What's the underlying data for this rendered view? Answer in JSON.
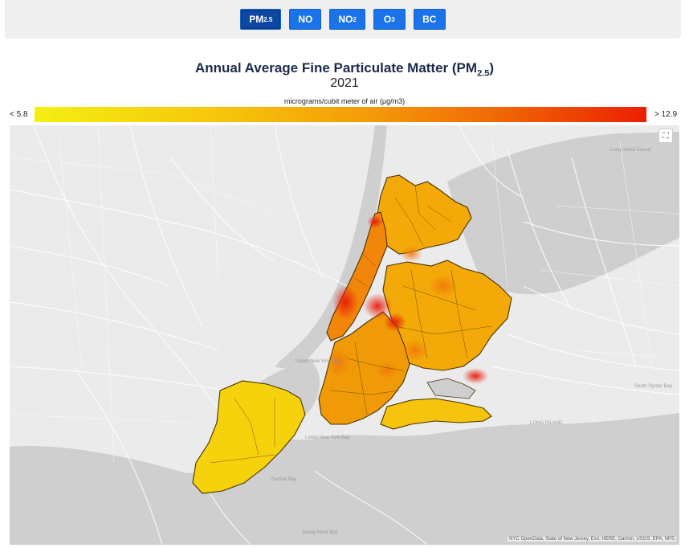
{
  "pollutant_buttons": [
    {
      "main": "PM",
      "sub": "2.5",
      "active": true
    },
    {
      "main": "NO",
      "sub": "",
      "active": false
    },
    {
      "main": "NO",
      "sub": "2",
      "active": false
    },
    {
      "main": "O",
      "sub": "3",
      "active": false
    },
    {
      "main": "BC",
      "sub": "",
      "active": false
    }
  ],
  "title": {
    "main": "Annual Average Fine Particulate Matter (PM",
    "sub": "2.5",
    "close": ")"
  },
  "year": "2021",
  "legend": {
    "units": "micrograms/cubit meter of air (μg/m3)",
    "min_label": "< 5.8",
    "max_label": "> 12.9",
    "colors": [
      "#f4ef12",
      "#f6c60c",
      "#f59a06",
      "#f06a04",
      "#ec1f00"
    ]
  },
  "map": {
    "place_labels": {
      "long_island_sound": "Long Island Sound",
      "upper_new_york_bay": "Upper New York Bay",
      "lower_new_york_bay": "Lower New York Bay",
      "raritan_bay": "Raritan Bay",
      "sandy_hook_bay": "Sandy Hook Bay",
      "long_island": "LONG ISLAND",
      "south_oyster_bay": "South Oyster Bay"
    },
    "attribution": "NYC OpenData, State of New Jersey, Esri, HERE, Garmin, USGS, EPA, NPS",
    "zoom_icon": "fullscreen-icon"
  }
}
